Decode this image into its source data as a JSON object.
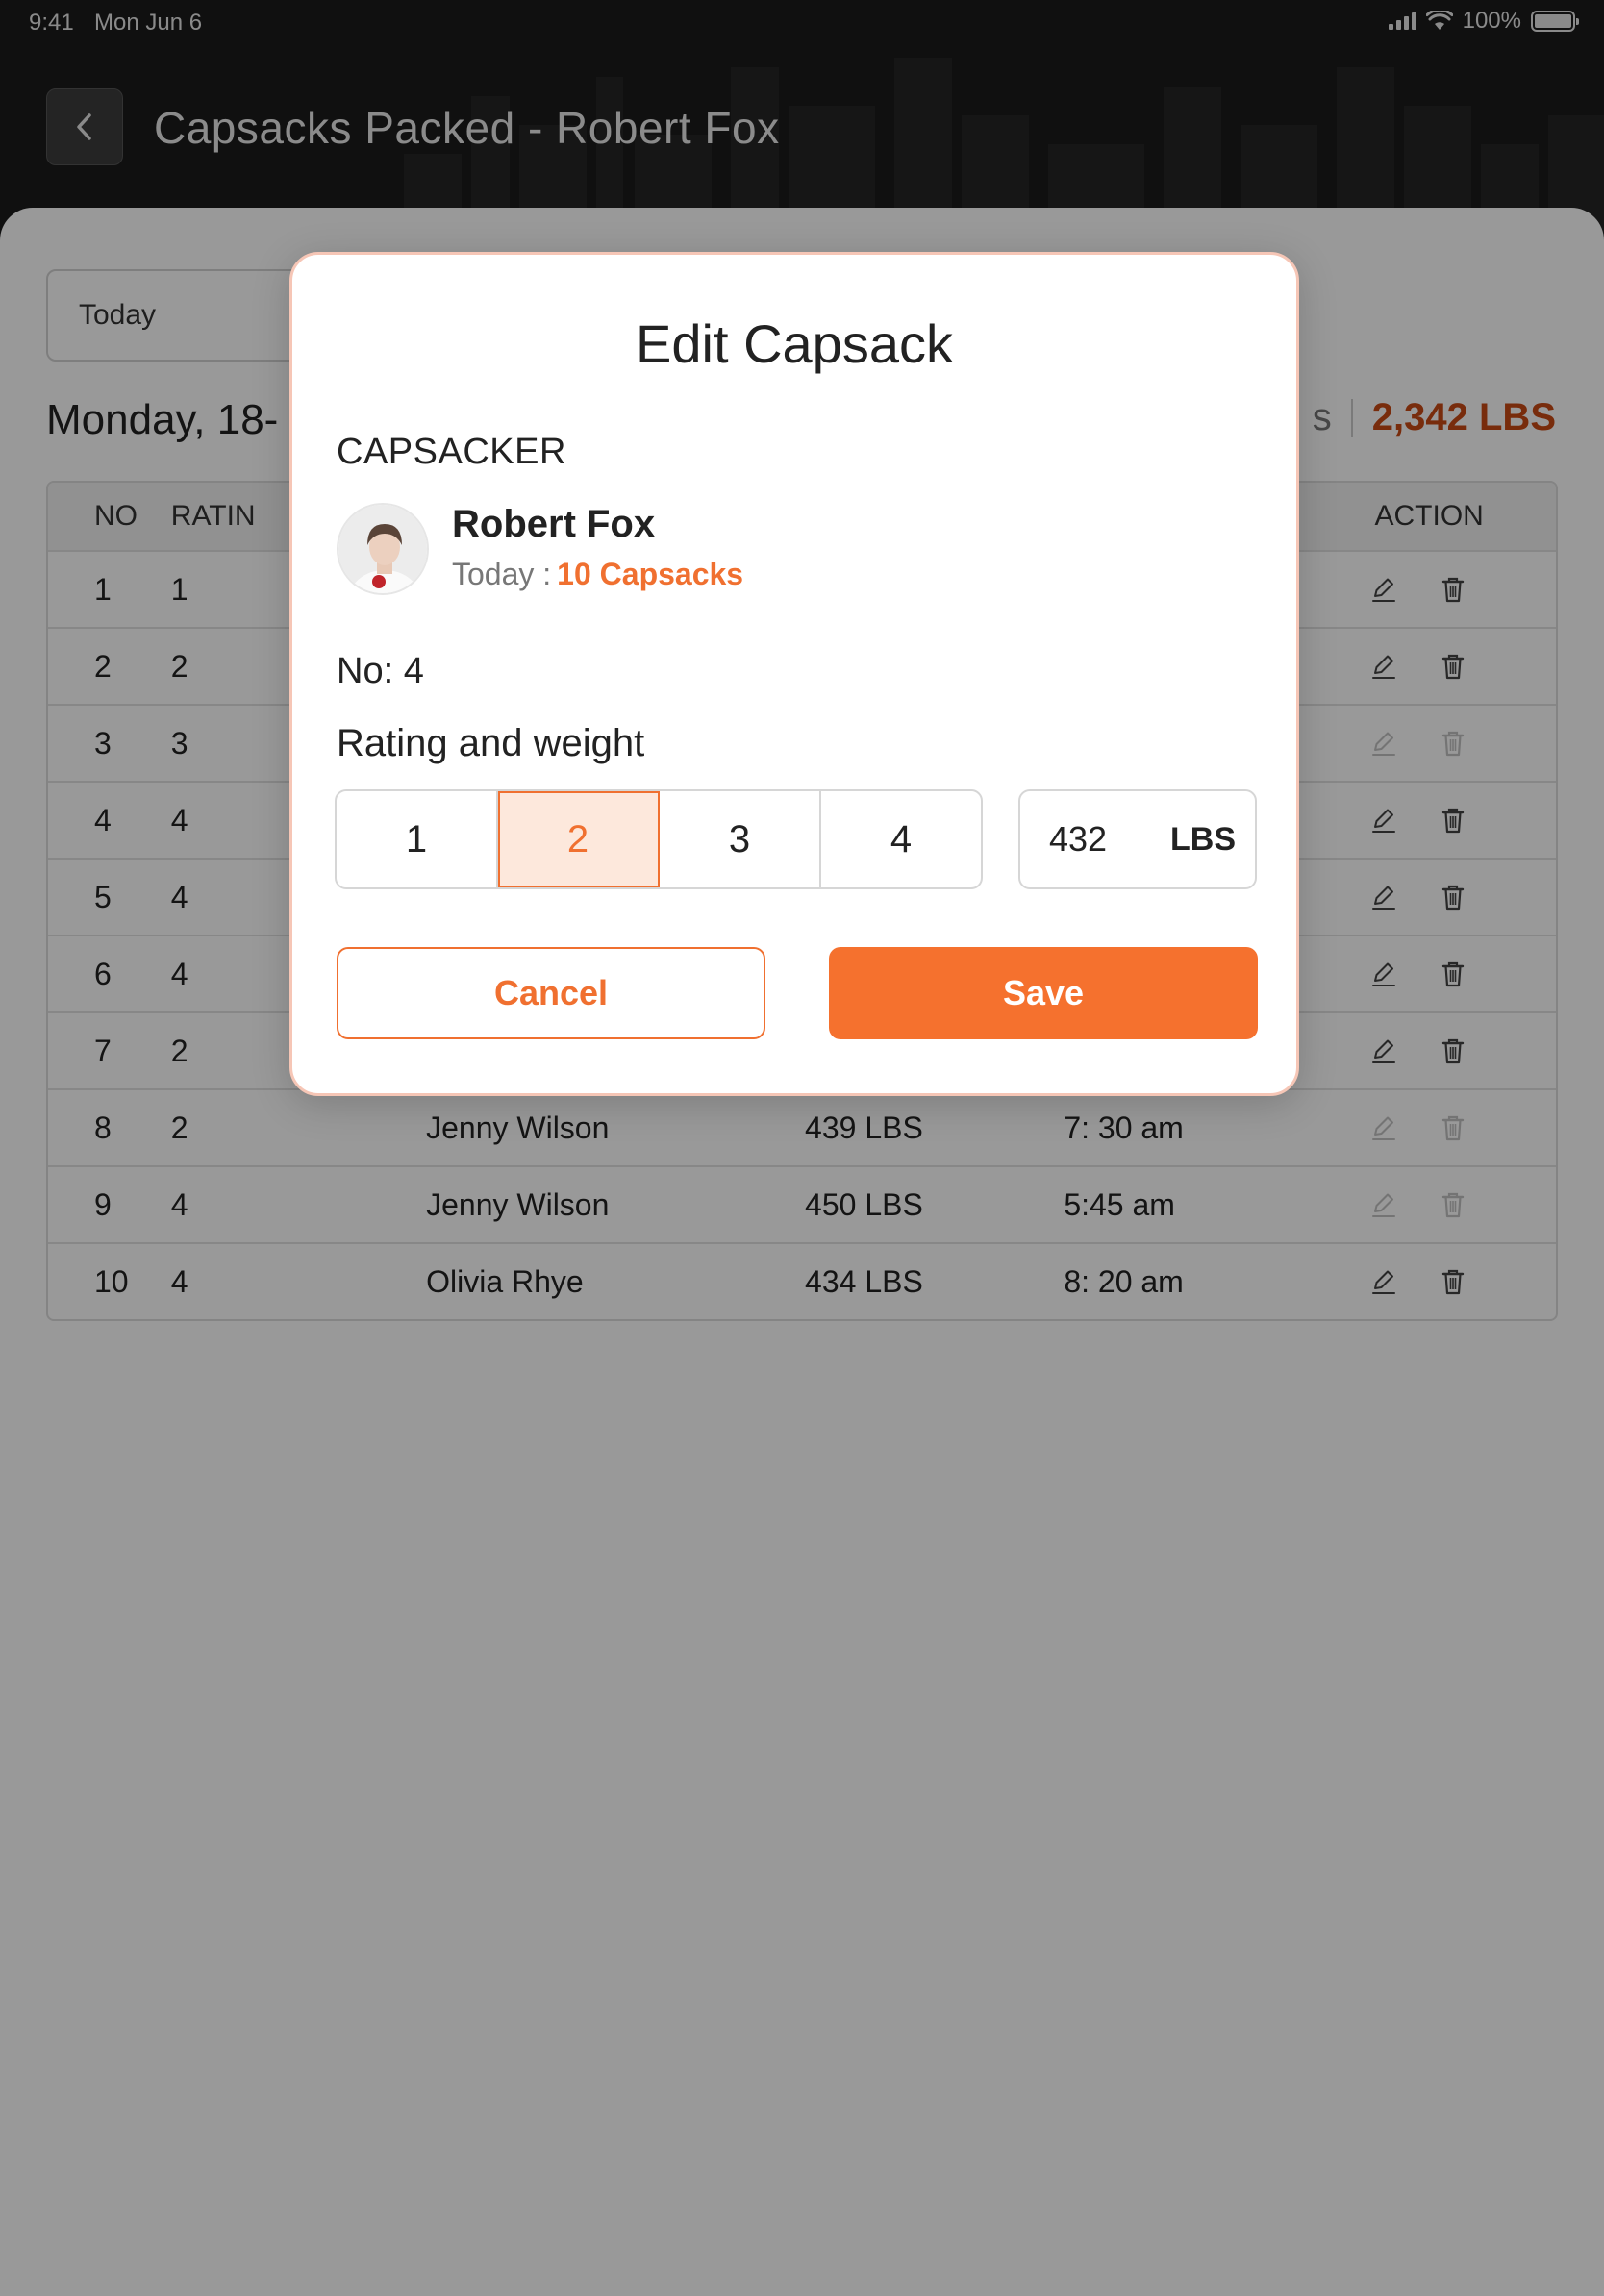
{
  "status_bar": {
    "time": "9:41",
    "date": "Mon Jun 6",
    "battery": "100%"
  },
  "header": {
    "title": "Capsacks Packed - Robert Fox"
  },
  "filter": {
    "value": "Today"
  },
  "summary": {
    "date": "Monday, 18-",
    "count_suffix": "s",
    "total_weight": "2,342 LBS"
  },
  "table": {
    "headers": {
      "no": "NO",
      "rating": "RATIN",
      "name": "",
      "weight": "",
      "time": "",
      "action": "ACTION"
    },
    "rows": [
      {
        "no": "1",
        "rating": "1",
        "name": "",
        "weight": "",
        "time": ""
      },
      {
        "no": "2",
        "rating": "2",
        "name": "",
        "weight": "",
        "time": ""
      },
      {
        "no": "3",
        "rating": "3",
        "name": "",
        "weight": "",
        "time": ""
      },
      {
        "no": "4",
        "rating": "4",
        "name": "",
        "weight": "",
        "time": ""
      },
      {
        "no": "5",
        "rating": "4",
        "name": "",
        "weight": "",
        "time": ""
      },
      {
        "no": "6",
        "rating": "4",
        "name": "",
        "weight": "",
        "time": ""
      },
      {
        "no": "7",
        "rating": "2",
        "name": "",
        "weight": "",
        "time": ""
      },
      {
        "no": "8",
        "rating": "2",
        "name": "Jenny Wilson",
        "weight": "439 LBS",
        "time": "7: 30 am"
      },
      {
        "no": "9",
        "rating": "4",
        "name": "Jenny Wilson",
        "weight": "450 LBS",
        "time": "5:45 am"
      },
      {
        "no": "10",
        "rating": "4",
        "name": "Olivia Rhye",
        "weight": "434 LBS",
        "time": "8: 20 am"
      }
    ],
    "row_actions_disabled": [
      false,
      false,
      true,
      false,
      false,
      false,
      false,
      true,
      true,
      false
    ]
  },
  "modal": {
    "title": "Edit Capsack",
    "section_label": "CAPSACKER",
    "user": {
      "name": "Robert Fox",
      "today_label": "Today :",
      "today_count": "10 Capsacks"
    },
    "number_label": "No: 4",
    "rating_label": "Rating and weight",
    "rating_options": [
      "1",
      "2",
      "3",
      "4"
    ],
    "selected_rating": "2",
    "weight_value": "432",
    "weight_unit": "LBS",
    "cancel_label": "Cancel",
    "save_label": "Save"
  },
  "colors": {
    "accent": "#f5712e",
    "accent_light": "#fde8dc",
    "total_weight": "#c94a14"
  },
  "icons": {
    "back": "chevron-left-icon",
    "edit": "pencil-icon",
    "delete": "trash-icon"
  }
}
